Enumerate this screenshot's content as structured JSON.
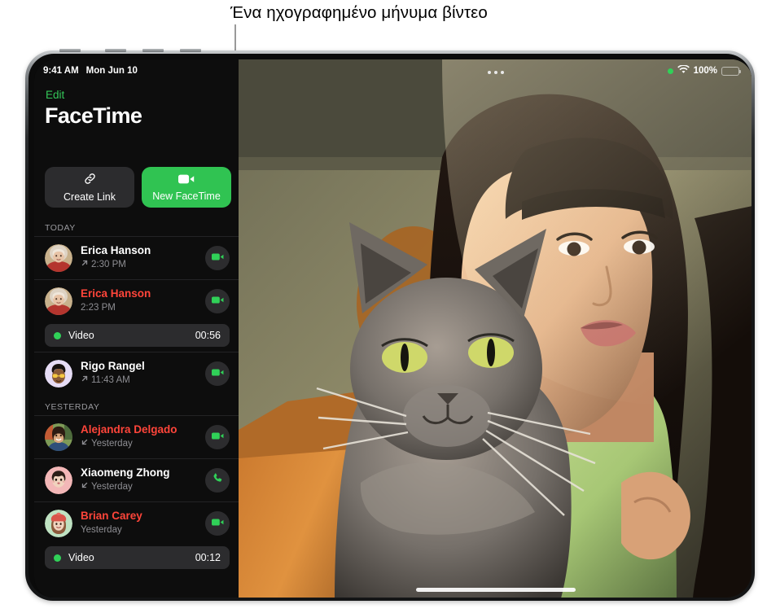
{
  "callout": {
    "text": "Ένα ηχογραφημένο μήνυμα βίντεο"
  },
  "status_bar": {
    "time": "9:41 AM",
    "date": "Mon Jun 10",
    "recording_indicator": "green-dot-icon",
    "wifi": "wifi-icon",
    "battery_percent": "100%",
    "battery_icon": "battery-full-icon"
  },
  "sidebar": {
    "edit_label": "Edit",
    "title": "FaceTime",
    "actions": [
      {
        "id": "create-link",
        "label": "Create Link",
        "icon": "link-icon",
        "style": "grey"
      },
      {
        "id": "new-facetime",
        "label": "New FaceTime",
        "icon": "video-camera-icon",
        "style": "green"
      }
    ],
    "sections": [
      {
        "header": "TODAY",
        "rows": [
          {
            "name": "Erica Hanson",
            "missed": false,
            "direction_icon": "arrow-outgoing-icon",
            "time": "2:30 PM",
            "action_icon": "video-camera-icon",
            "avatar": "photo-erica",
            "message": null
          },
          {
            "name": "Erica Hanson",
            "missed": true,
            "direction_icon": null,
            "time": "2:23 PM",
            "action_icon": "video-camera-icon",
            "avatar": "photo-erica",
            "message": {
              "dot": "green-dot-icon",
              "label": "Video",
              "duration": "00:56"
            }
          },
          {
            "name": "Rigo Rangel",
            "missed": false,
            "direction_icon": "arrow-outgoing-icon",
            "time": "11:43 AM",
            "action_icon": "video-camera-icon",
            "avatar": "memoji-rigo",
            "message": null
          }
        ]
      },
      {
        "header": "YESTERDAY",
        "rows": [
          {
            "name": "Alejandra Delgado",
            "missed": true,
            "direction_icon": "arrow-incoming-icon",
            "time": "Yesterday",
            "action_icon": "video-camera-icon",
            "avatar": "photo-alejandra",
            "message": null
          },
          {
            "name": "Xiaomeng Zhong",
            "missed": false,
            "direction_icon": "arrow-incoming-icon",
            "time": "Yesterday",
            "action_icon": "phone-icon",
            "avatar": "memoji-xiaomeng",
            "message": null
          },
          {
            "name": "Brian Carey",
            "missed": true,
            "direction_icon": null,
            "time": "Yesterday",
            "action_icon": "video-camera-icon",
            "avatar": "memoji-brian",
            "message": {
              "dot": "green-dot-icon",
              "label": "Video",
              "duration": "00:12"
            }
          }
        ]
      }
    ]
  },
  "video_pane": {
    "more_button": "more-options-icon",
    "home_indicator": "home-indicator",
    "description": "Woman holding a grey cat, sunlit room"
  },
  "colors": {
    "accent_green": "#30c352",
    "missed_red": "#ff453a",
    "sidebar_bg": "#0d0d0d",
    "chip_bg": "#2c2c2e",
    "secondary_text": "#8e8e93"
  }
}
